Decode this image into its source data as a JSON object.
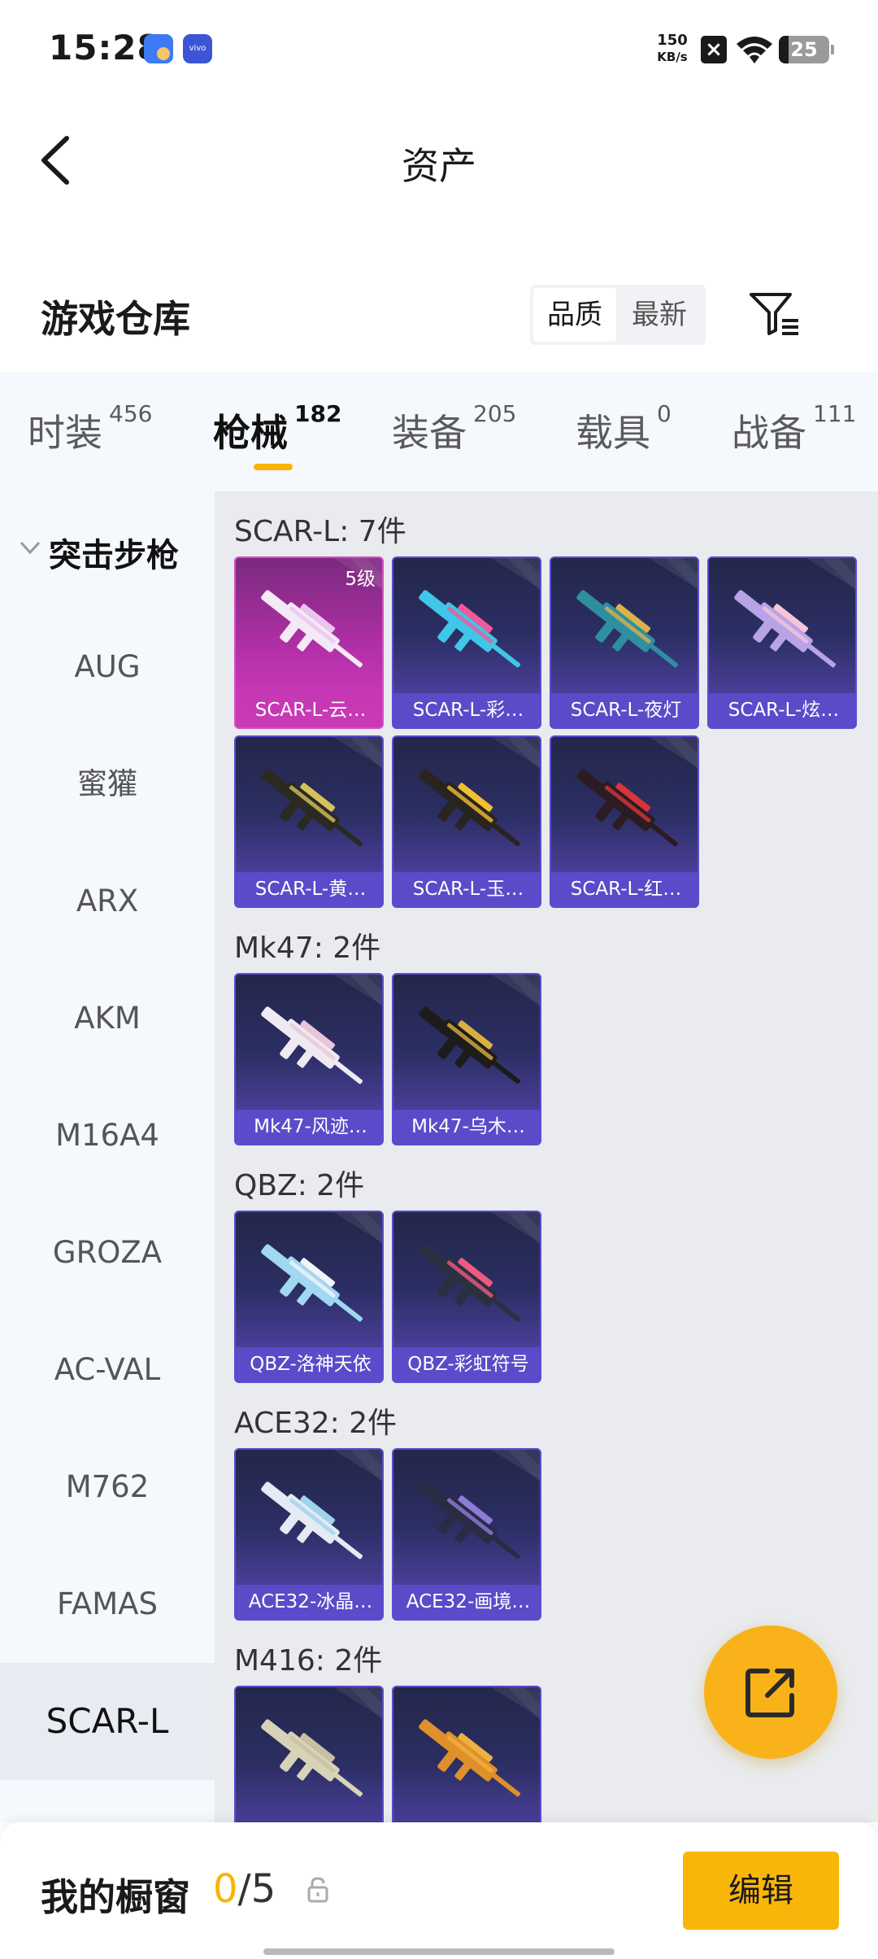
{
  "status_bar": {
    "time": "15:28",
    "speed_value": "150",
    "speed_unit": "KB/s",
    "battery": "25"
  },
  "header": {
    "title": "资产"
  },
  "warehouse": {
    "title": "游戏仓库",
    "sort_options": [
      "品质",
      "最新"
    ],
    "sort_active": "品质"
  },
  "tabs": [
    {
      "label": "时装",
      "count": "456"
    },
    {
      "label": "枪械",
      "count": "182"
    },
    {
      "label": "装备",
      "count": "205"
    },
    {
      "label": "载具",
      "count": "0"
    },
    {
      "label": "战备",
      "count": "111"
    }
  ],
  "active_tab": "枪械",
  "sidebar": {
    "category": "突击步枪",
    "items": [
      "AUG",
      "蜜獾",
      "ARX",
      "AKM",
      "M16A4",
      "GROZA",
      "AC-VAL",
      "M762",
      "FAMAS",
      "SCAR-L"
    ],
    "active_item": "SCAR-L"
  },
  "groups": [
    {
      "title": "SCAR-L: 7件",
      "items": [
        {
          "name": "SCAR-L-云…",
          "badge": "5级",
          "style": "pink",
          "gun_color": "#f5e9f5",
          "accent": "#e8c6f0"
        },
        {
          "name": "SCAR-L-彩…",
          "style": "blue",
          "gun_color": "#3fc6e8",
          "accent": "#f05a9a"
        },
        {
          "name": "SCAR-L-夜灯",
          "style": "blue",
          "gun_color": "#2e8fa0",
          "accent": "#d8b24a"
        },
        {
          "name": "SCAR-L-炫…",
          "style": "blue",
          "gun_color": "#b7a3e6",
          "accent": "#f6c3d9"
        },
        {
          "name": "SCAR-L-黄…",
          "style": "blue",
          "gun_color": "#2a2a22",
          "accent": "#d6c25a"
        },
        {
          "name": "SCAR-L-玉…",
          "style": "blue",
          "gun_color": "#2a2420",
          "accent": "#f0c030"
        },
        {
          "name": "SCAR-L-红…",
          "style": "blue",
          "gun_color": "#2a1c22",
          "accent": "#d8343a"
        }
      ]
    },
    {
      "title": "Mk47: 2件",
      "items": [
        {
          "name": "Mk47-风迹…",
          "style": "blue",
          "gun_color": "#efeaf2",
          "accent": "#e8c6d8"
        },
        {
          "name": "Mk47-乌木…",
          "style": "blue",
          "gun_color": "#1e1c1a",
          "accent": "#d9b040"
        }
      ]
    },
    {
      "title": "QBZ: 2件",
      "items": [
        {
          "name": "QBZ-洛神天依",
          "style": "blue",
          "gun_color": "#9fd8f0",
          "accent": "#f2f4fa"
        },
        {
          "name": "QBZ-彩虹符号",
          "style": "blue",
          "gun_color": "#2a3040",
          "accent": "#f05a80"
        }
      ]
    },
    {
      "title": "ACE32: 2件",
      "items": [
        {
          "name": "ACE32-冰晶…",
          "style": "blue",
          "gun_color": "#e6eaf4",
          "accent": "#9fd4ee"
        },
        {
          "name": "ACE32-画境…",
          "style": "blue",
          "gun_color": "#2a2c44",
          "accent": "#8e7ad8"
        }
      ]
    },
    {
      "title": "M416: 2件",
      "items": [
        {
          "name": "",
          "style": "blue",
          "gun_color": "#d8d2b8",
          "accent": "#c8c0a0"
        },
        {
          "name": "",
          "style": "blue",
          "gun_color": "#e0902a",
          "accent": "#f0b040"
        }
      ]
    }
  ],
  "bottom_bar": {
    "label": "我的橱窗",
    "current": "0",
    "separator": "/",
    "max": "5",
    "edit_label": "编辑"
  },
  "colors": {
    "accent_yellow": "#f9b60a",
    "card_blue": "#5b4bd0",
    "card_pink": "#d44ec4"
  },
  "icons": [
    "back-arrow-icon",
    "filter-icon",
    "chevron-down-icon",
    "share-icon",
    "lock-icon",
    "wifi-icon",
    "close-box-icon"
  ]
}
